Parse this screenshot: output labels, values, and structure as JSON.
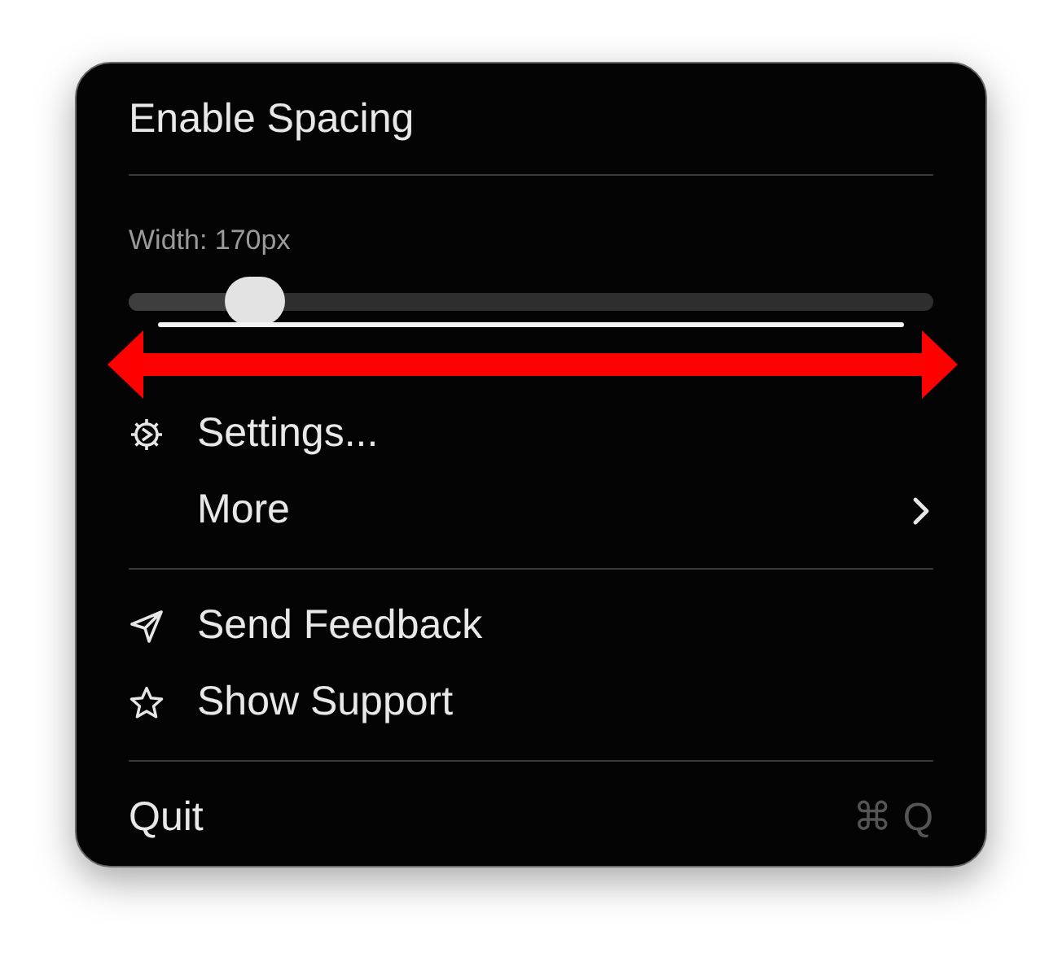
{
  "menu": {
    "items": [
      {
        "kind": "item",
        "label": "Enable Spacing"
      },
      {
        "kind": "divider"
      },
      {
        "kind": "slider",
        "label": "Width: 170px",
        "level": 0.13
      },
      {
        "kind": "item",
        "label": "Settings..."
      },
      {
        "kind": "submenu",
        "label": "More"
      },
      {
        "kind": "divider"
      },
      {
        "kind": "item",
        "label": "Send Feedback"
      },
      {
        "kind": "item",
        "label": "Show Support"
      },
      {
        "kind": "divider"
      },
      {
        "kind": "item",
        "label": "Quit",
        "shortcut": "⌘ Q"
      }
    ]
  }
}
